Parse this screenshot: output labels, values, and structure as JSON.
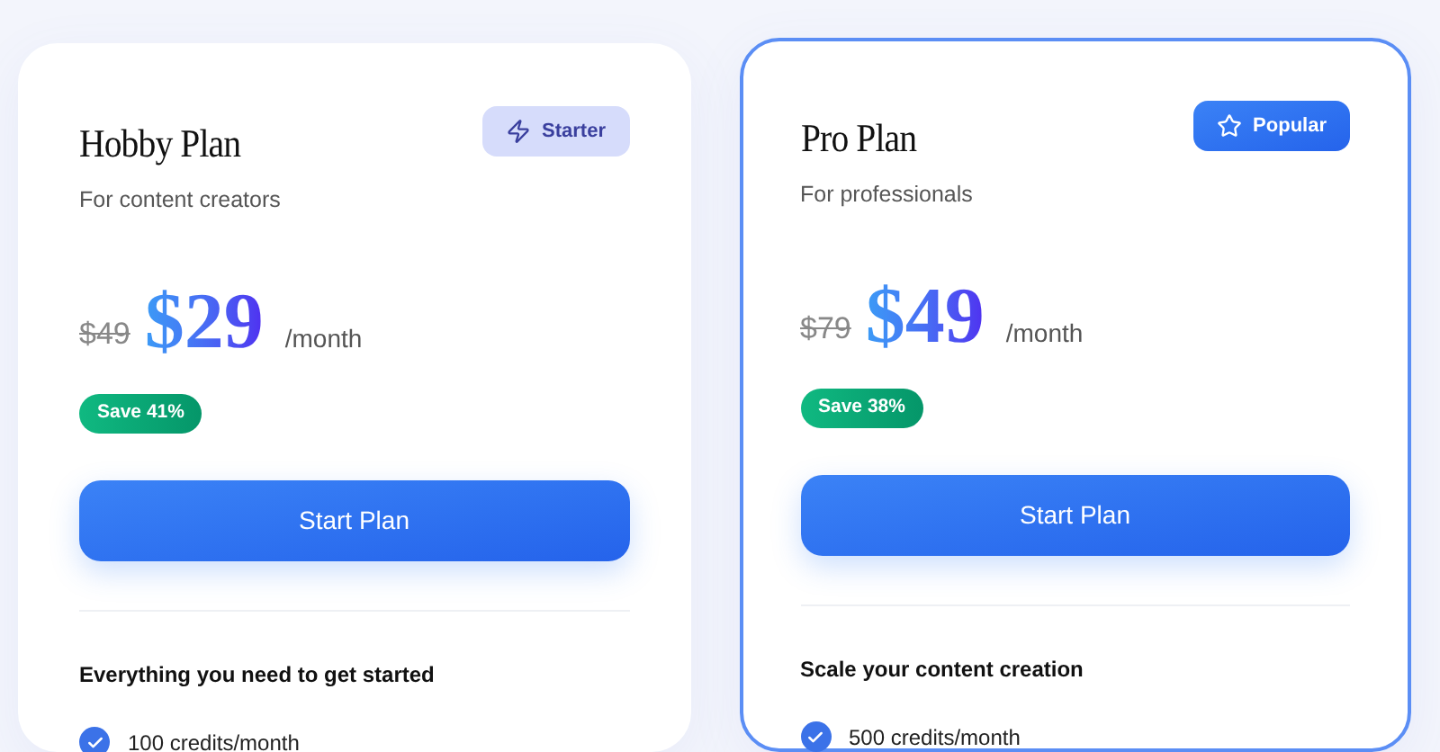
{
  "plans": [
    {
      "name": "Hobby Plan",
      "featured": false,
      "badge": {
        "kind": "starter",
        "label": "Starter"
      },
      "subtitle": "For content creators",
      "old_price": "$49",
      "price": "$29",
      "period": "/month",
      "savings": "Save 41%",
      "button": "Start Plan",
      "features_heading": "Everything you need to get started",
      "features": [
        "100 credits/month"
      ]
    },
    {
      "name": "Pro Plan",
      "featured": true,
      "badge": {
        "kind": "popular",
        "label": "Popular"
      },
      "subtitle": "For professionals",
      "old_price": "$79",
      "price": "$49",
      "period": "/month",
      "savings": "Save 38%",
      "button": "Start Plan",
      "features_heading": "Scale your content creation",
      "features": [
        "500 credits/month"
      ]
    }
  ]
}
